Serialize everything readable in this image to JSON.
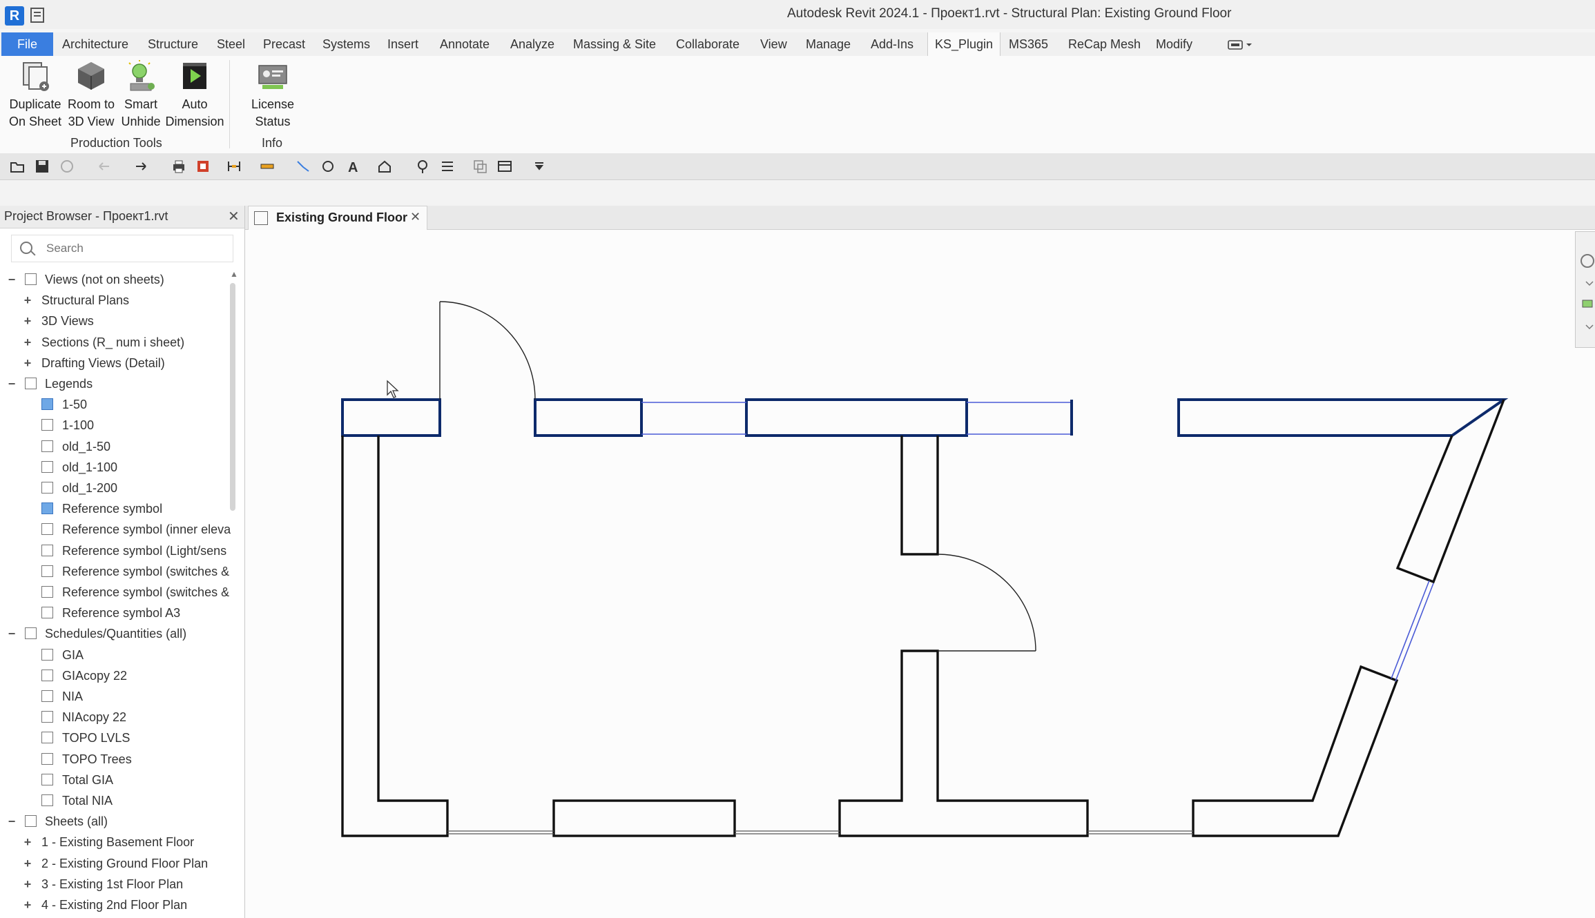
{
  "window": {
    "title": "Autodesk Revit 2024.1 - Проект1.rvt - Structural Plan: Existing Ground Floor"
  },
  "ribbon": {
    "tabs": [
      "File",
      "Architecture",
      "Structure",
      "Steel",
      "Precast",
      "Systems",
      "Insert",
      "Annotate",
      "Analyze",
      "Massing & Site",
      "Collaborate",
      "View",
      "Manage",
      "Add-Ins",
      "KS_Plugin",
      "MS365",
      "ReCap Mesh",
      "Modify"
    ],
    "active_tab": "KS_Plugin",
    "tools": [
      {
        "line1": "Duplicate",
        "line2": "On Sheet",
        "icon": "duplicate-sheet-icon"
      },
      {
        "line1": "Room to",
        "line2": "3D View",
        "icon": "room-3d-icon"
      },
      {
        "line1": "Smart",
        "line2": "Unhide",
        "icon": "lightbulb-icon"
      },
      {
        "line1": "Auto",
        "line2": "Dimension",
        "icon": "play-dimension-icon"
      },
      {
        "line1": "License Status",
        "line2": "",
        "icon": "license-icon"
      }
    ],
    "panels": [
      {
        "label": "Production Tools"
      },
      {
        "label": "Info"
      }
    ]
  },
  "browser": {
    "title": "Project Browser - Проект1.rvt",
    "search": {
      "placeholder": "Search",
      "value": ""
    },
    "tree": [
      {
        "label": "Views (not on sheets)",
        "level": 0,
        "toggle": "−",
        "icon": "views-icon"
      },
      {
        "label": "Structural Plans",
        "level": 1,
        "toggle": "+"
      },
      {
        "label": "3D Views",
        "level": 1,
        "toggle": "+"
      },
      {
        "label": "Sections (R_ num i sheet)",
        "level": 1,
        "toggle": "+"
      },
      {
        "label": "Drafting Views (Detail)",
        "level": 1,
        "toggle": "+"
      },
      {
        "label": "Legends",
        "level": 0,
        "toggle": "−",
        "icon": "legend-icon"
      },
      {
        "label": "1-50",
        "level": 2,
        "icon": "legend-item-icon",
        "selected": true
      },
      {
        "label": "1-100",
        "level": 2,
        "icon": "legend-item-icon"
      },
      {
        "label": "old_1-50",
        "level": 2,
        "icon": "legend-item-icon"
      },
      {
        "label": "old_1-100",
        "level": 2,
        "icon": "legend-item-icon"
      },
      {
        "label": "old_1-200",
        "level": 2,
        "icon": "legend-item-icon"
      },
      {
        "label": "Reference symbol",
        "level": 2,
        "icon": "legend-item-icon",
        "selected": true
      },
      {
        "label": "Reference symbol (inner eleva",
        "level": 2,
        "icon": "legend-item-icon"
      },
      {
        "label": "Reference symbol (Light/sens",
        "level": 2,
        "icon": "legend-item-icon"
      },
      {
        "label": "Reference symbol (switches &",
        "level": 2,
        "icon": "legend-item-icon"
      },
      {
        "label": "Reference symbol (switches &",
        "level": 2,
        "icon": "legend-item-icon"
      },
      {
        "label": "Reference symbol A3",
        "level": 2,
        "icon": "legend-item-icon"
      },
      {
        "label": "Schedules/Quantities (all)",
        "level": 0,
        "toggle": "−",
        "icon": "schedule-icon"
      },
      {
        "label": "GIA",
        "level": 2,
        "icon": "schedule-item-icon"
      },
      {
        "label": "GIAcopy 22",
        "level": 2,
        "icon": "schedule-item-icon"
      },
      {
        "label": "NIA",
        "level": 2,
        "icon": "schedule-item-icon"
      },
      {
        "label": "NIAcopy 22",
        "level": 2,
        "icon": "schedule-item-icon"
      },
      {
        "label": "TOPO LVLS",
        "level": 2,
        "icon": "schedule-item-icon"
      },
      {
        "label": "TOPO Trees",
        "level": 2,
        "icon": "schedule-item-icon"
      },
      {
        "label": "Total GIA",
        "level": 2,
        "icon": "schedule-item-icon"
      },
      {
        "label": "Total NIA",
        "level": 2,
        "icon": "schedule-item-icon"
      },
      {
        "label": "Sheets (all)",
        "level": 0,
        "toggle": "−",
        "icon": "sheets-icon"
      },
      {
        "label": "1 - Existing Basement Floor",
        "level": 1,
        "toggle": "+"
      },
      {
        "label": "2 - Existing Ground Floor Plan",
        "level": 1,
        "toggle": "+"
      },
      {
        "label": "3 - Existing 1st Floor Plan",
        "level": 1,
        "toggle": "+"
      },
      {
        "label": "4 - Existing 2nd Floor Plan",
        "level": 1,
        "toggle": "+"
      }
    ]
  },
  "view_tab": {
    "label": "Existing Ground Floor"
  },
  "colors": {
    "accent": "#3a7ee0",
    "selected_wall": "#0d2a6b",
    "wall": "#111111",
    "window_line": "#4a5bd6"
  }
}
